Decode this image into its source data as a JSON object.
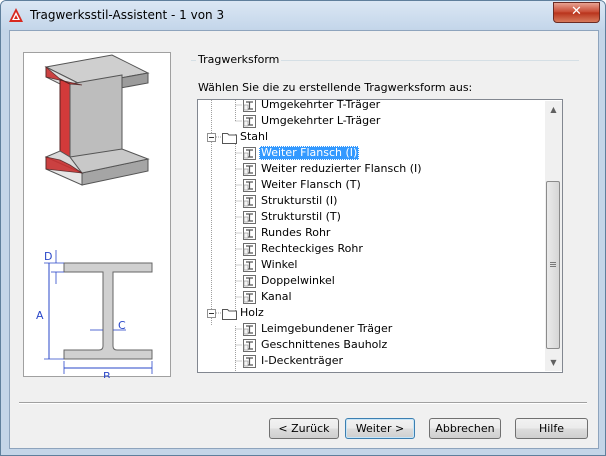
{
  "window": {
    "title": "Tragwerksstil-Assistent - 1 von 3",
    "close_glyph": "✕"
  },
  "group": {
    "title": "Tragwerksform",
    "prompt": "Wählen Sie die zu erstellende Tragwerksform aus:"
  },
  "diagram": {
    "label_a": "A",
    "label_b": "B",
    "label_c": "C",
    "label_d": "D"
  },
  "tree": {
    "items": [
      {
        "label": "Umgekehrter T-Träger"
      },
      {
        "label": "Umgekehrter L-Träger"
      },
      {
        "label": "Stahl"
      },
      {
        "label": "Weiter Flansch (I)"
      },
      {
        "label": "Weiter reduzierter Flansch (I)"
      },
      {
        "label": "Weiter Flansch (T)"
      },
      {
        "label": "Strukturstil (I)"
      },
      {
        "label": "Strukturstil (T)"
      },
      {
        "label": "Rundes Rohr"
      },
      {
        "label": "Rechteckiges Rohr"
      },
      {
        "label": "Winkel"
      },
      {
        "label": "Doppelwinkel"
      },
      {
        "label": "Kanal"
      },
      {
        "label": "Holz"
      },
      {
        "label": "Leimgebundener Träger"
      },
      {
        "label": "Geschnittenes Bauholz"
      },
      {
        "label": "I-Deckenträger"
      }
    ]
  },
  "buttons": {
    "back": "< Zurück",
    "next": "Weiter >",
    "cancel": "Abbrechen",
    "help": "Hilfe"
  }
}
